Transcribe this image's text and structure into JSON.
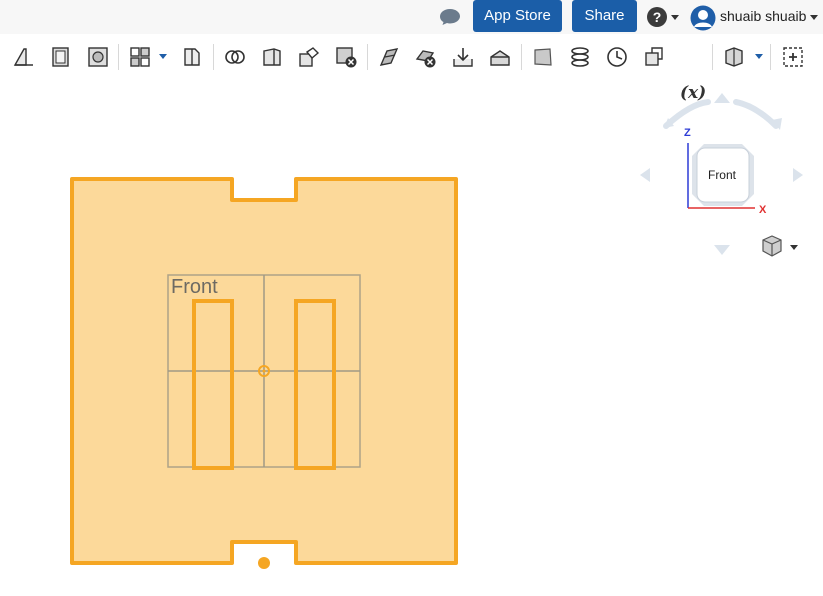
{
  "header": {
    "app_store_label": "App Store",
    "share_label": "Share",
    "help_icon": "question-circle-icon",
    "user": {
      "name": "shuaib shuaib",
      "avatar": "user-avatar-icon"
    },
    "chat_icon": "comment-icon"
  },
  "toolbar": {
    "items": [
      "sketch-icon",
      "part-studio-icon",
      "assembly-icon",
      "view-layout-icon",
      "section-view-icon",
      "boolean-icon",
      "extrude-icon",
      "fillet-icon",
      "delete-part-icon",
      "split-icon",
      "delete-face-icon",
      "import-icon",
      "modify-icon",
      "plane-icon",
      "helix-icon",
      "measure-icon",
      "transform-icon",
      "variable-icon",
      "render-mode-icon",
      "zoom-fit-icon"
    ],
    "variable_label": "(x)"
  },
  "viewcube": {
    "face_label": "Front",
    "axis_z": "Z",
    "axis_x": "X"
  },
  "sketch": {
    "plane_label": "Front"
  },
  "colors": {
    "accent": "#1b5ea8",
    "part_fill": "#fcd99a",
    "part_stroke": "#f5a623",
    "axis_x": "#e03030",
    "axis_z": "#2c3bd6"
  }
}
